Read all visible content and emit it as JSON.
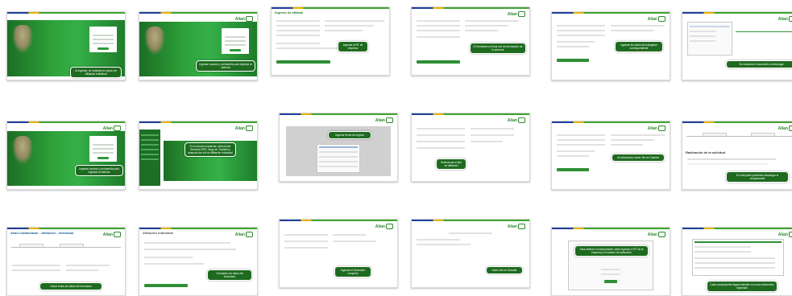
{
  "brand": {
    "logo": "Alian",
    "accent": "#2a8a2c",
    "dark_green": "#1e6b1f"
  },
  "slides": [
    {
      "callout": "Al ingresar, se mostrará la opción de Afiliación Individual"
    },
    {
      "callout": "Ingresar usuario y contraseña para ingresar al sistema"
    },
    {
      "header": "Ingreso de afiliado",
      "callout": "Ingresar el RT de empresa"
    },
    {
      "callout": "El formulario se llena con la información de la persona"
    },
    {
      "callout": "Ingresar los datos del trabajador correspondiente"
    },
    {
      "callout": "Se mostrará el documento a descargar"
    },
    {
      "callout": "Ingresar usuario y contraseña para ingresar al sistema"
    },
    {
      "callout": "En la sección izquierda, seleccionar Servicios EPS, luego en Trámites y después dar clic en Afiliación Individual"
    },
    {
      "callout": "Ingresar fecha de ingreso"
    },
    {
      "callout": "Seleccionar el tipo de afiliación"
    },
    {
      "callout": "Al seleccionar, hacer clic en Guardar"
    },
    {
      "header": "Radicación de la solicitud",
      "callout": "En esta parte podremos descargar el comprobante"
    },
    {
      "header": "Alian Colaborador - Afiliación - Individual",
      "callout": "Llenar todos los datos del formulario"
    },
    {
      "header": "Afiliación Individual",
      "callout": "Completar los datos del formulario"
    },
    {
      "callout": "Ingresar el formulario completo"
    },
    {
      "callout": "Hacer clic en Guardar"
    },
    {
      "callout": "Para obtener el comprobante, debe ingresar el RT de la empresa y el número de radicación"
    },
    {
      "callout": "Cada comprobante llegará también al correo electrónico registrado"
    }
  ]
}
